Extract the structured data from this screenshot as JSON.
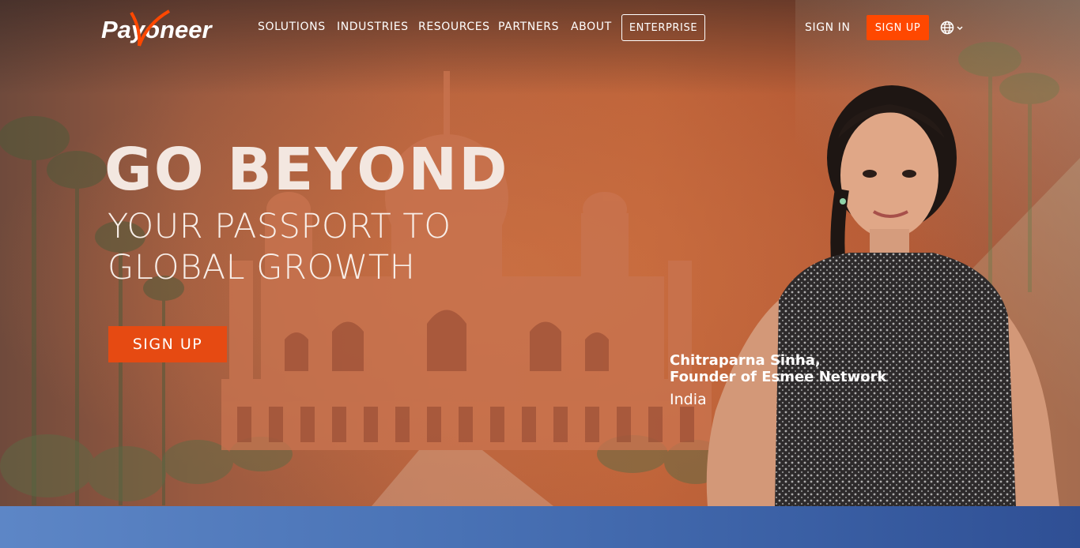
{
  "nav": {
    "logo_text": "Payoneer",
    "links": [
      "SOLUTIONS",
      "INDUSTRIES",
      "RESOURCES",
      "PARTNERS",
      "ABOUT"
    ],
    "enterprise": "ENTERPRISE",
    "sign_in": "SIGN IN",
    "sign_up": "SIGN UP",
    "language_icon": "globe-icon"
  },
  "hero": {
    "headline": "GO BEYOND",
    "subline": [
      "YOUR PASSPORT TO",
      "GLOBAL GROWTH"
    ],
    "cta": "SIGN UP",
    "testimonial": {
      "name": "Chitraparna Sinha,",
      "title": "Founder of Esmee Network",
      "country": "India"
    }
  },
  "colors": {
    "accent": "#ff4800",
    "cta": "#e64a12",
    "strip": "#4a73b6"
  }
}
